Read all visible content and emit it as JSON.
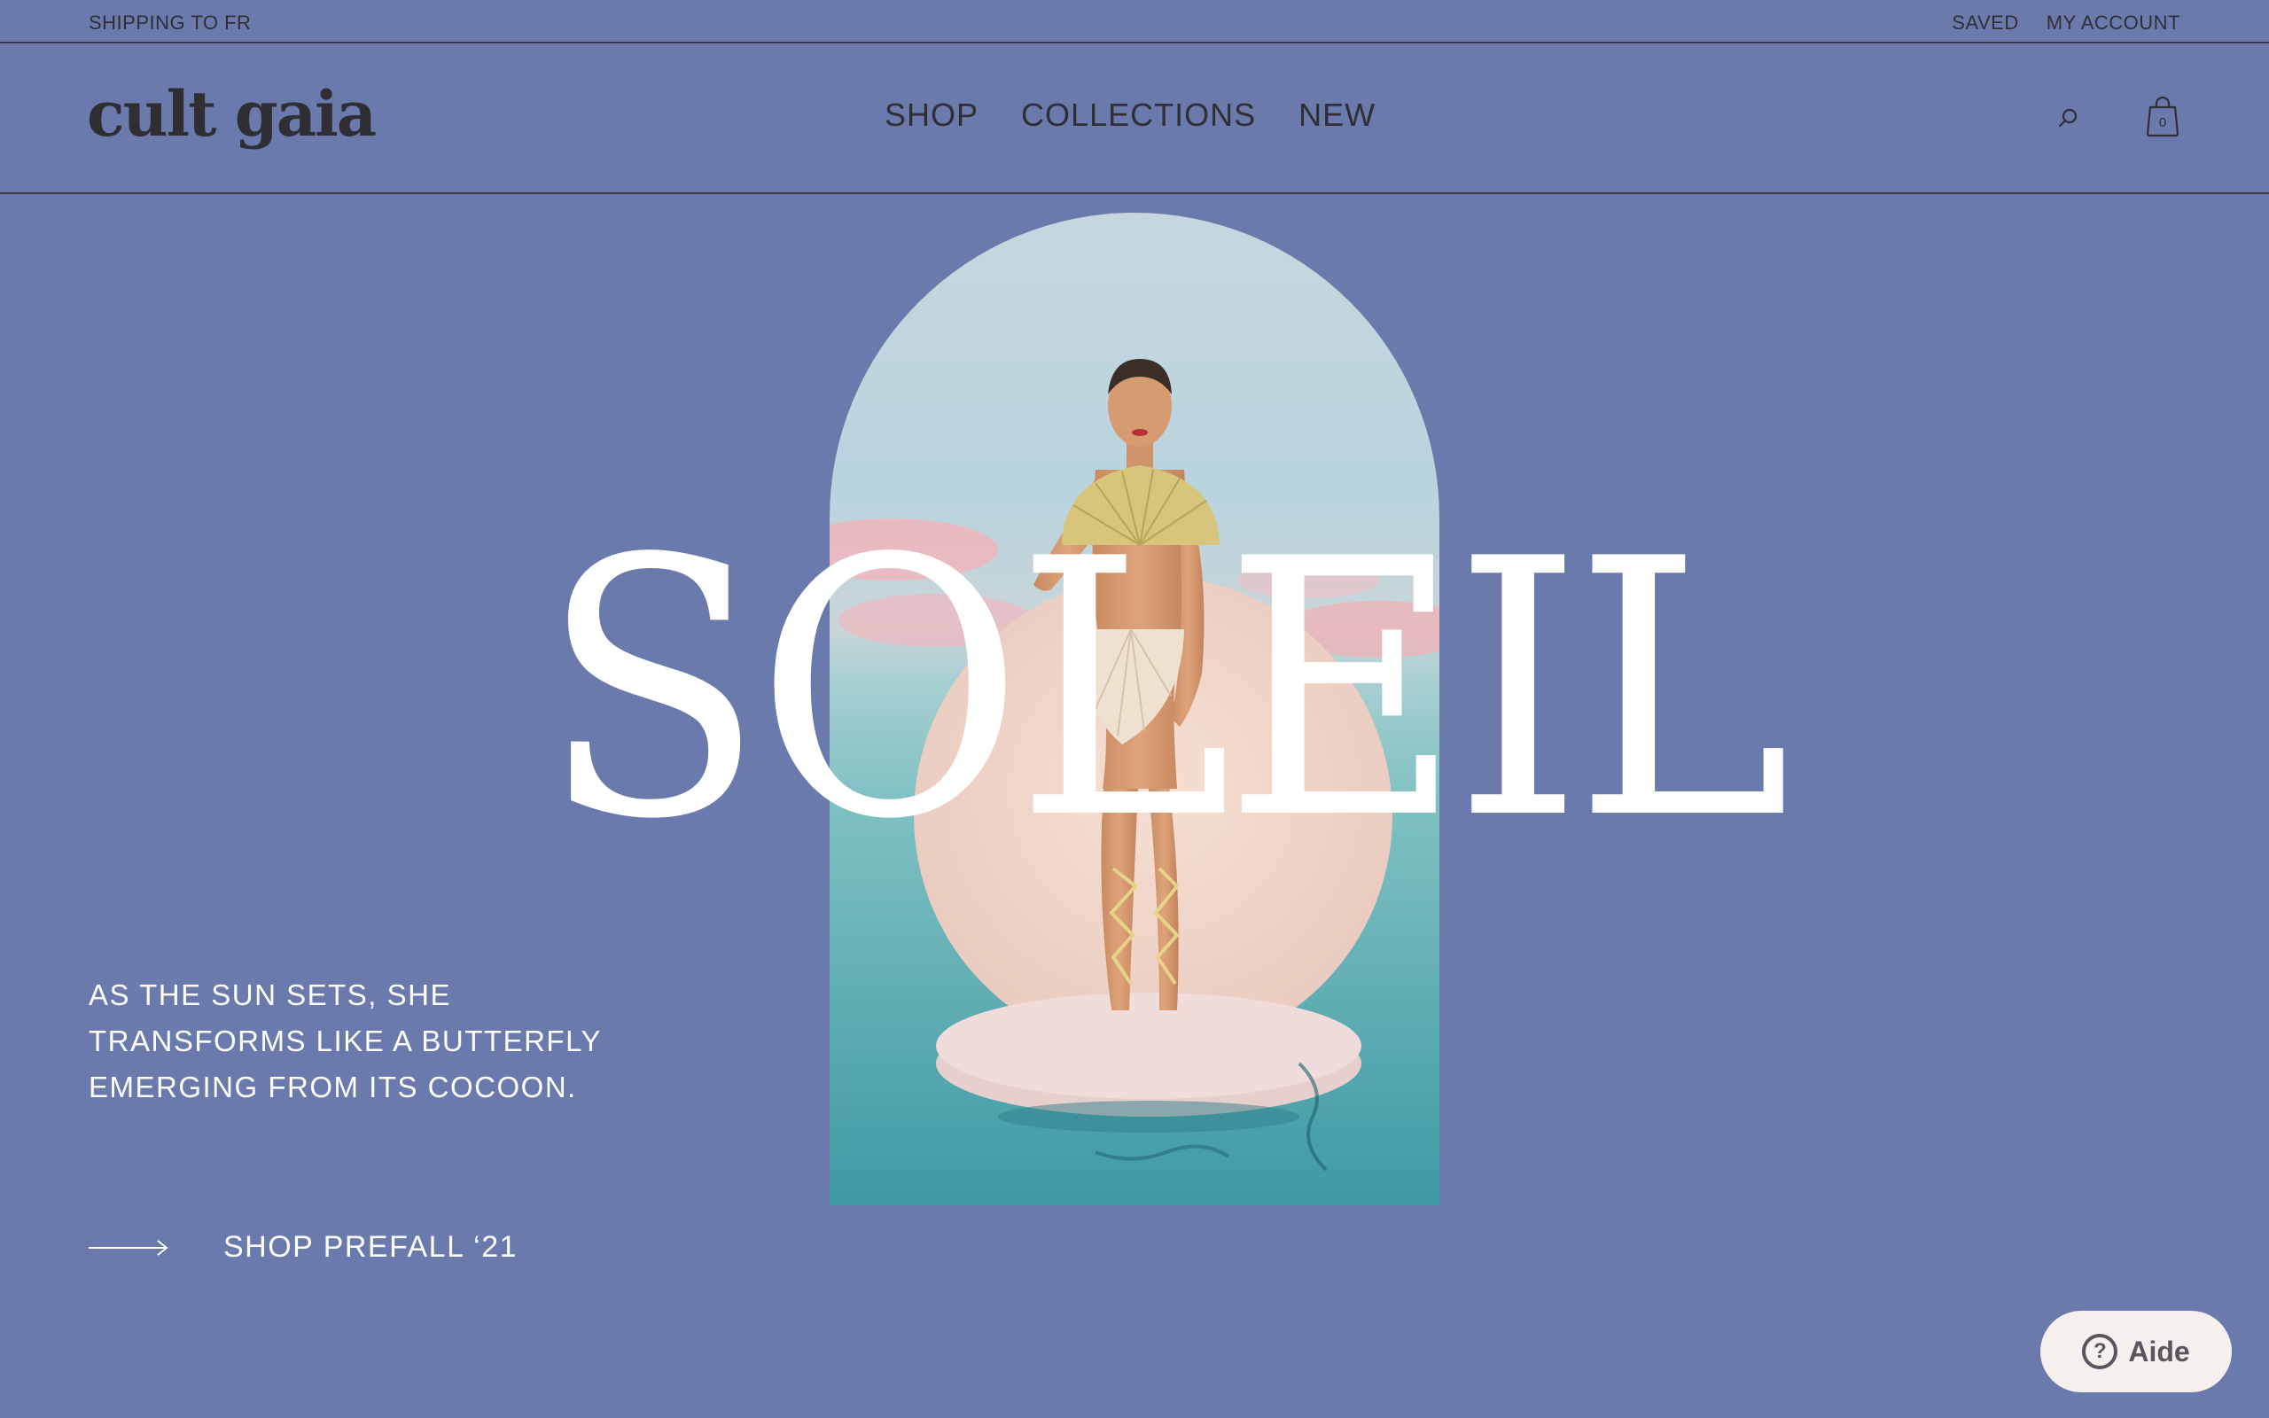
{
  "topbar": {
    "shipping": "SHIPPING TO FR",
    "saved": "SAVED",
    "account": "MY ACCOUNT"
  },
  "header": {
    "logo": "cult gaia",
    "nav": [
      "SHOP",
      "COLLECTIONS",
      "NEW"
    ],
    "bag_count": "0",
    "icons": {
      "search": "search-icon",
      "bag": "shopping-bag-icon"
    }
  },
  "hero": {
    "headline": "SOLEIL",
    "tagline_lines": [
      "AS THE SUN SETS, SHE",
      "TRANSFORMS LIKE A BUTTERFLY",
      "EMERGING FROM ITS COCOON."
    ],
    "cta_label": "SHOP PREFALL ‘21"
  },
  "help": {
    "label": "Aide",
    "icon": "question-circle-icon"
  },
  "colors": {
    "background": "#6a7aad",
    "text_dark": "#2f2f35",
    "text_light": "#ffffff",
    "help_bg": "#f5efed"
  }
}
